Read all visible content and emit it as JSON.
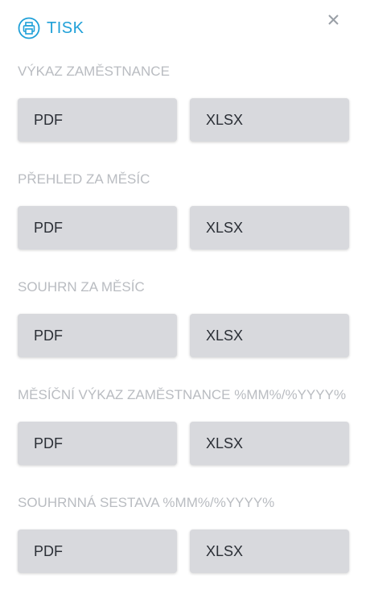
{
  "header": {
    "title": "TISK",
    "icon": "printer-icon",
    "accent_color": "#1fa0d8",
    "close_icon": "close-icon"
  },
  "sections": [
    {
      "label": "VÝKAZ ZAMĚSTNANCE",
      "buttons": [
        "PDF",
        "XLSX"
      ]
    },
    {
      "label": "PŘEHLED ZA MĚSÍC",
      "buttons": [
        "PDF",
        "XLSX"
      ]
    },
    {
      "label": "SOUHRN ZA MĚSÍC",
      "buttons": [
        "PDF",
        "XLSX"
      ]
    },
    {
      "label": "MĚSÍČNÍ VÝKAZ ZAMĚSTNANCE %MM%/%YYYY%",
      "buttons": [
        "PDF",
        "XLSX"
      ]
    },
    {
      "label": "SOUHRNNÁ SESTAVA %MM%/%YYYY%",
      "buttons": [
        "PDF",
        "XLSX"
      ]
    }
  ]
}
